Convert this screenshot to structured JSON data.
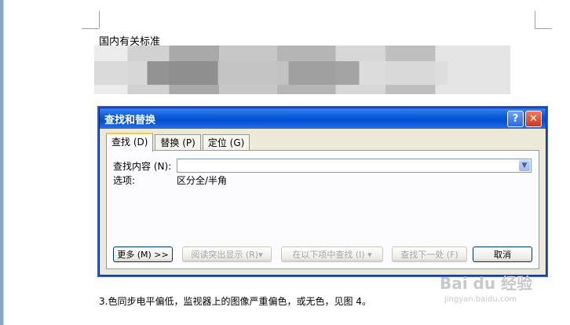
{
  "document": {
    "heading": "国内有关标准",
    "bottom_text": "3.色同步电平偏低，监视器上的图像严重偏色，或无色，见图 4。"
  },
  "dialog": {
    "title": "查找和替换",
    "help_label": "?",
    "close_label": "✕",
    "tabs": [
      "查找 (D)",
      "替换 (P)",
      "定位 (G)"
    ],
    "find_label": "查找内容 (N):",
    "find_value": "",
    "options_label": "选项:",
    "options_value": "区分全/半角",
    "buttons": {
      "more": "更多 (M) >>",
      "highlight": "阅读突出显示 (R)▾",
      "find_in": "在以下项中查找 (I) ▾",
      "find_next": "查找下一处 (F)",
      "cancel": "取消"
    }
  },
  "watermark": {
    "brand": "Bai du 经验",
    "url": "jingyan.baidu.com"
  }
}
